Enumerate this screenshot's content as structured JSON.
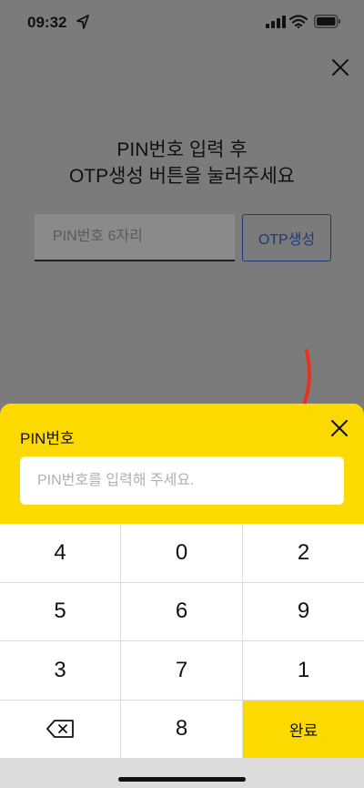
{
  "status_bar": {
    "time": "09:32",
    "icons": [
      "location-arrow-icon",
      "signal-icon",
      "wifi-icon",
      "battery-icon"
    ]
  },
  "page": {
    "title_line1": "PIN번호 입력 후",
    "title_line2": "OTP생성 버튼을 눌러주세요",
    "pin_placeholder": "PIN번호 6자리",
    "otp_button_label": "OTP생성",
    "close_icon": "close-icon"
  },
  "sheet": {
    "title": "PIN번호",
    "input_placeholder": "PIN번호를 입력해 주세요.",
    "close_icon": "close-icon"
  },
  "keypad": {
    "keys": [
      "4",
      "0",
      "2",
      "5",
      "6",
      "9",
      "3",
      "7",
      "1",
      "backspace",
      "8",
      "완료"
    ],
    "done_label": "완료"
  },
  "colors": {
    "overlay_gray": "#7b7b7b",
    "sheet_yellow": "#fcd900",
    "otp_button_border": "#1e3a78",
    "annotation_red": "#e8321e"
  }
}
